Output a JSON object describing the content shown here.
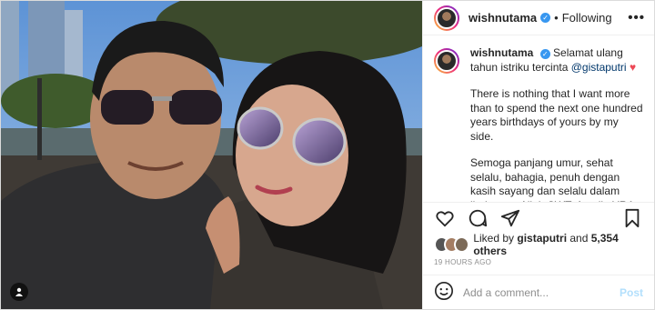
{
  "header": {
    "username": "wishnutama",
    "separator": "•",
    "follow_label": "Following",
    "more_label": "•••"
  },
  "caption": {
    "username": "wishnutama",
    "line1_prefix": "Selamat ulang tahun istriku tercinta ",
    "mention": "@gistaputri",
    "heart": "♥",
    "para2": "There is nothing that I want more than to spend the next one hundred years birthdays of yours by my side.",
    "para3": "Semoga panjang umur, sehat selalu, bahagia, penuh dengan kasih sayang dan selalu dalam lindungan Allah SWT, Aamiin YRA🙏"
  },
  "actions": {
    "icons": [
      "heart-icon",
      "comment-icon",
      "share-icon",
      "bookmark-icon"
    ]
  },
  "likes": {
    "prefix": "Liked by ",
    "user": "gistaputri",
    "middle": " and ",
    "count": "5,354 others"
  },
  "time": "19 HOURS AGO",
  "comment": {
    "placeholder": "Add a comment...",
    "post_label": "Post"
  },
  "colors": {
    "accent": "#3897f0",
    "mention": "#00376b",
    "post_disabled": "#b2dffc",
    "heart": "#ed4956"
  }
}
